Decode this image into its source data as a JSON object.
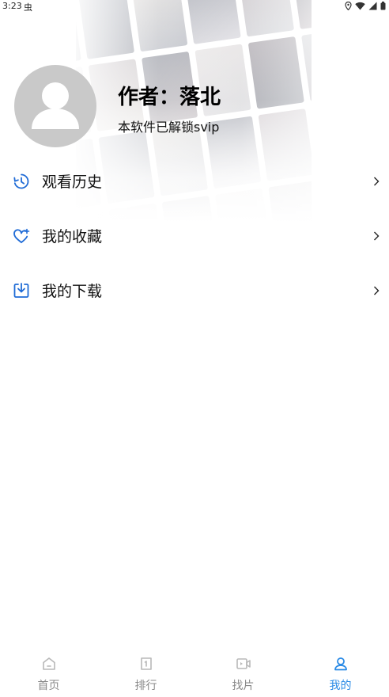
{
  "status_bar": {
    "time": "3:23",
    "notification_glyph": "虫"
  },
  "profile": {
    "name": "作者：落北",
    "subtitle": "本软件已解锁svip"
  },
  "menu": [
    {
      "label": "观看历史",
      "icon": "history-icon"
    },
    {
      "label": "我的收藏",
      "icon": "favorite-heart-icon"
    },
    {
      "label": "我的下载",
      "icon": "download-icon"
    }
  ],
  "bottom_nav": [
    {
      "label": "首页",
      "icon": "home-icon",
      "active": false
    },
    {
      "label": "排行",
      "icon": "ranking-icon",
      "active": false
    },
    {
      "label": "找片",
      "icon": "video-camera-icon",
      "active": false
    },
    {
      "label": "我的",
      "icon": "user-icon",
      "active": true
    }
  ],
  "colors": {
    "accent": "#2b8be6",
    "menu_icon": "#1f6bd6",
    "inactive_nav": "#b8b8b8",
    "avatar_bg": "#c9c9c9"
  }
}
